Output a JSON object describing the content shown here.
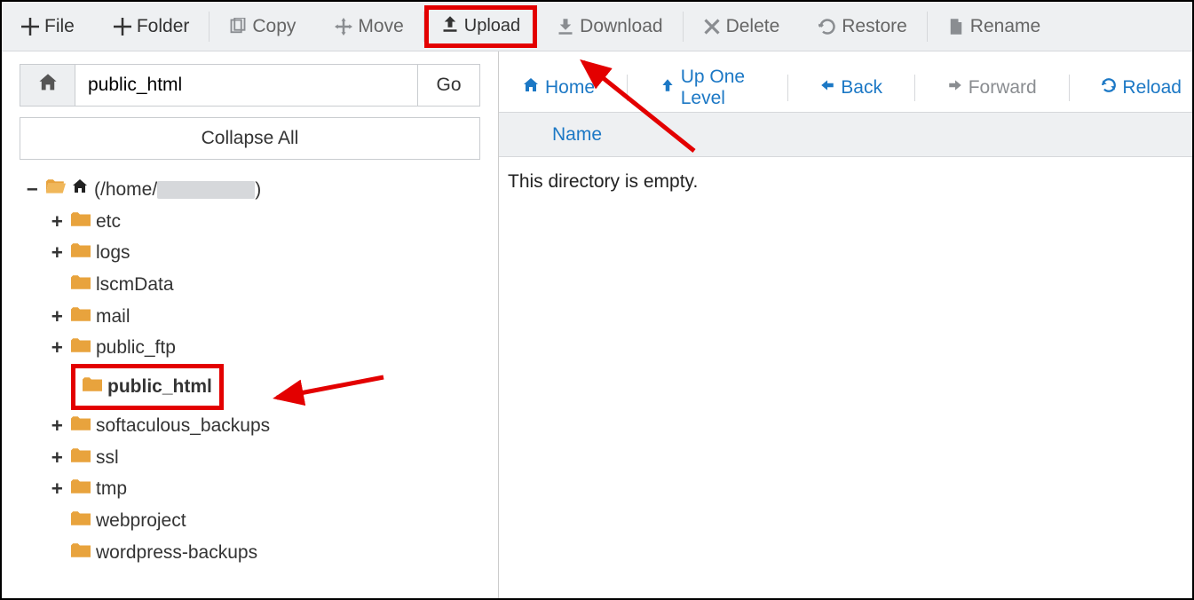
{
  "toolbar": {
    "file": "File",
    "folder": "Folder",
    "copy": "Copy",
    "move": "Move",
    "upload": "Upload",
    "download": "Download",
    "delete": "Delete",
    "restore": "Restore",
    "rename": "Rename"
  },
  "sidebar": {
    "path_input": "public_html",
    "go": "Go",
    "collapse_all": "Collapse All",
    "root_prefix": "(/home/",
    "root_suffix": ")",
    "items": [
      {
        "label": "etc",
        "expandable": true
      },
      {
        "label": "logs",
        "expandable": true
      },
      {
        "label": "lscmData",
        "expandable": false
      },
      {
        "label": "mail",
        "expandable": true
      },
      {
        "label": "public_ftp",
        "expandable": true
      },
      {
        "label": "public_html",
        "expandable": false,
        "highlight": true
      },
      {
        "label": "softaculous_backups",
        "expandable": true
      },
      {
        "label": "ssl",
        "expandable": true
      },
      {
        "label": "tmp",
        "expandable": true
      },
      {
        "label": "webproject",
        "expandable": false
      },
      {
        "label": "wordpress-backups",
        "expandable": false
      }
    ]
  },
  "navbar": {
    "home": "Home",
    "up": "Up One Level",
    "back": "Back",
    "forward": "Forward",
    "reload": "Reload"
  },
  "table": {
    "col_name": "Name",
    "empty": "This directory is empty."
  },
  "colors": {
    "folder": "#e8a33d",
    "link": "#1c78c5",
    "highlight": "#e30000"
  }
}
